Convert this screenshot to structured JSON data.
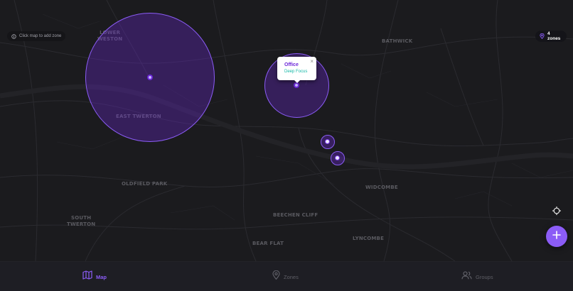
{
  "map": {
    "hint": "Click map to add zone",
    "zone_count": "4 zones",
    "area_labels": [
      "LOWER\nWESTON",
      "EAST TWERTON",
      "BATHWICK",
      "OLDFIELD PARK",
      "SOUTH\nTWERTON",
      "WIDCOMBE",
      "BEECHEN CLIFF",
      "LYNCOMBE",
      "BEAR FLAT"
    ],
    "popup": {
      "title": "Office",
      "subtitle": "Deep Focus",
      "close": "×"
    },
    "colors": {
      "zone_fill": "#6d28d9",
      "zone_stroke": "#8b5cf6",
      "accent": "#8b5cf6",
      "focus_teal": "#14b8a6"
    },
    "icons": {
      "hint": "info-icon",
      "count": "pin-icon",
      "locate": "crosshair-icon",
      "fab": "plus-icon"
    }
  },
  "nav": {
    "items": [
      {
        "label": "Map",
        "icon": "map-icon",
        "active": true
      },
      {
        "label": "Zones",
        "icon": "pin-icon",
        "active": false
      },
      {
        "label": "Groups",
        "icon": "users-icon",
        "active": false
      }
    ]
  }
}
